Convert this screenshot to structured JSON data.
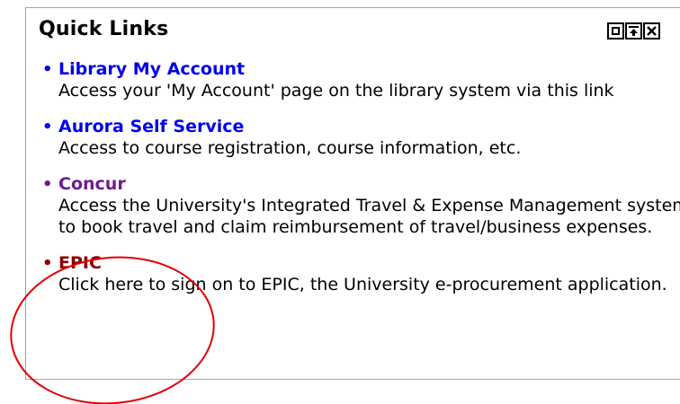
{
  "panel": {
    "title": "Quick Links",
    "controls": [
      "minimize-icon",
      "move-up-icon",
      "close-icon"
    ]
  },
  "links": [
    {
      "title": "Library My Account",
      "description": "Access your 'My Account' page on the library system via this link",
      "color": "#0000ee"
    },
    {
      "title": "Aurora Self Service",
      "description": "Access to course registration, course information, etc.",
      "color": "#0000ee"
    },
    {
      "title": "Concur",
      "description": "Access the University's Integrated Travel & Expense Management system to book travel and claim reimbursement of travel/business expenses.",
      "color": "#6c1d90"
    },
    {
      "title": "EPIC",
      "description": "Click here to sign on to EPIC, the University e-procurement application.",
      "color": "#8b0000"
    }
  ],
  "annotation": {
    "shape": "ellipse",
    "color": "#e30000"
  }
}
